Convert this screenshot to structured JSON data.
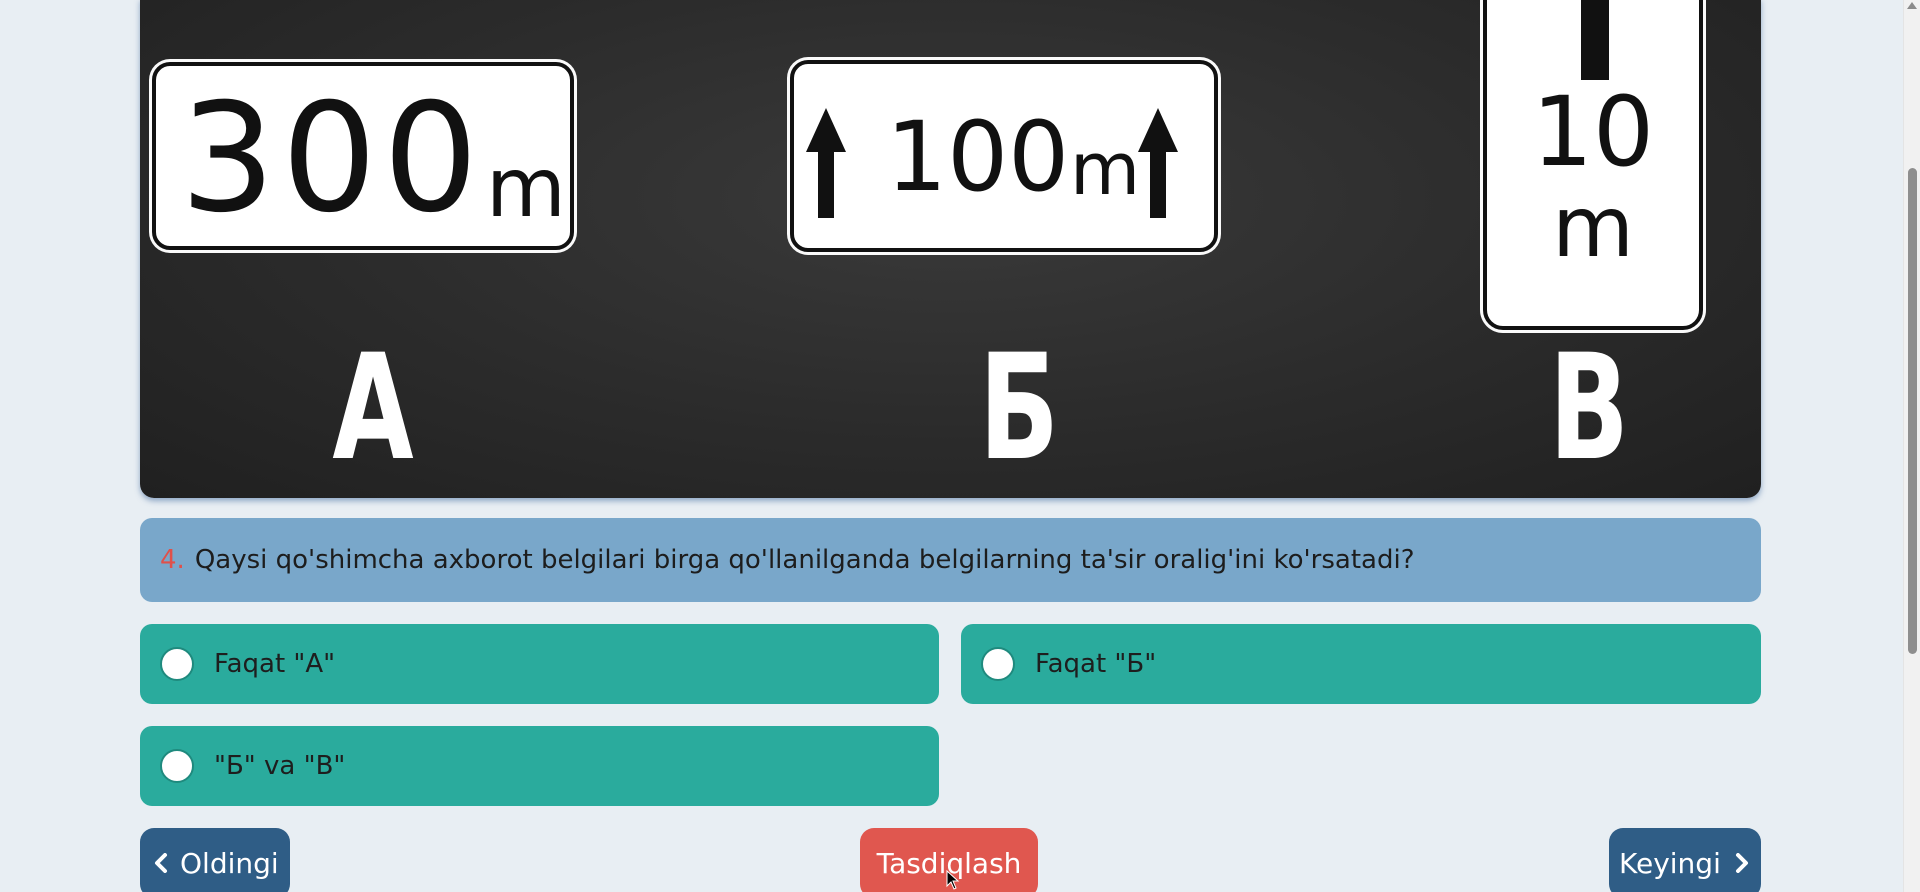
{
  "image": {
    "signs": [
      {
        "number": "300",
        "unit": "m"
      },
      {
        "number": "100",
        "unit": "m"
      },
      {
        "number": "10",
        "unit": "m"
      }
    ],
    "letters": [
      "А",
      "Б",
      "В"
    ]
  },
  "question": {
    "number": "4.",
    "text": "Qaysi qo'shimcha axborot belgilari birga qo'llanilganda belgilarning ta'sir oralig'ini ko'rsatadi?"
  },
  "answers": [
    {
      "label": "Faqat \"А\""
    },
    {
      "label": "Faqat \"Б\""
    },
    {
      "label": "\"Б\" va \"В\""
    }
  ],
  "nav": {
    "prev_label": "Oldingi",
    "confirm_label": "Tasdiqlash",
    "next_label": "Keyingi"
  },
  "colors": {
    "question_bg": "#79a7ca",
    "question_number": "#e0504a",
    "answer_bg": "#2aab9d",
    "nav_button": "#2f5d86",
    "confirm_button": "#e0574f",
    "page_bg": "#e8eef3"
  }
}
